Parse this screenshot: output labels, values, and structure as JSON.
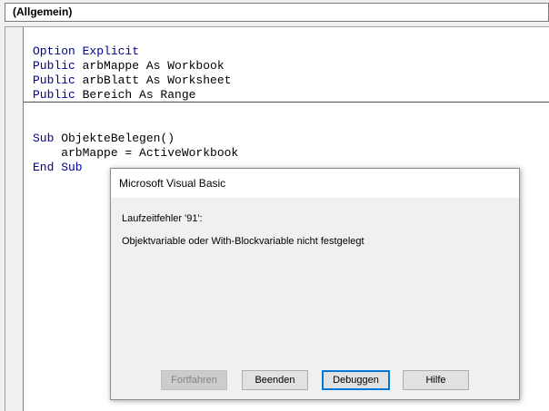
{
  "object_combo": {
    "value": "(Allgemein)"
  },
  "code": {
    "declarations": [
      {
        "keyword": "Option Explicit",
        "rest": ""
      },
      {
        "keyword": "Public",
        "rest": " arbMappe As Workbook"
      },
      {
        "keyword": "Public",
        "rest": " arbBlatt As Worksheet"
      },
      {
        "keyword": "Public",
        "rest": " Bereich As Range"
      }
    ],
    "procedure": [
      {
        "keyword": "Sub",
        "rest": " ObjekteBelegen()"
      },
      {
        "keyword": "",
        "rest": "    arbMappe = ActiveWorkbook"
      },
      {
        "keyword": "End Sub",
        "rest": ""
      }
    ]
  },
  "dialog": {
    "title": "Microsoft Visual Basic",
    "error_code": "Laufzeitfehler '91':",
    "message": "Objektvariable oder With-Blockvariable nicht festgelegt",
    "buttons": {
      "continue": "Fortfahren",
      "end": "Beenden",
      "debug": "Debuggen",
      "help": "Hilfe"
    }
  },
  "colors": {
    "keyword": "#00008b",
    "default_button_border": "#0078d7"
  }
}
